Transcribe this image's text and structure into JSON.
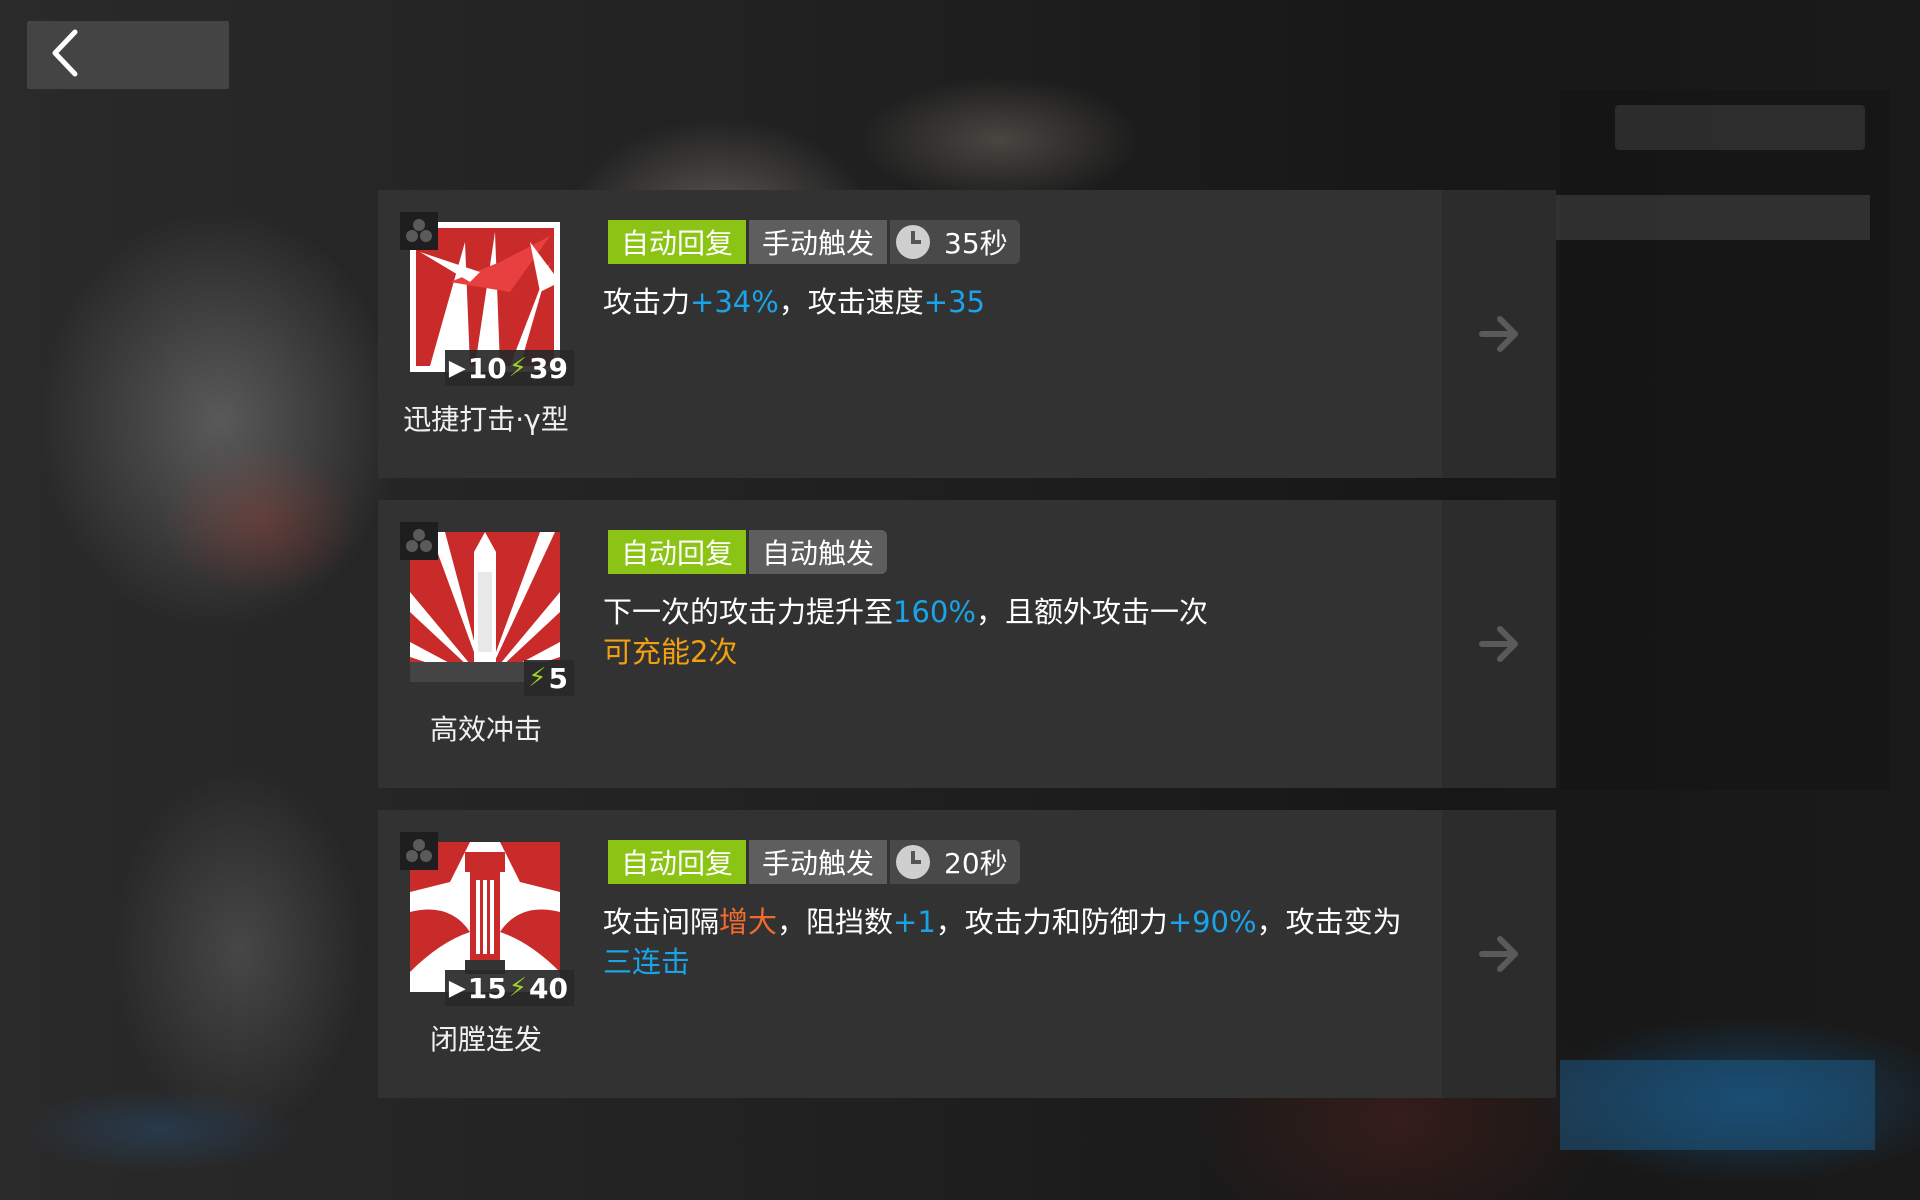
{
  "skills": [
    {
      "name": "迅捷打击·γ型",
      "init_sp": "10",
      "sp_cost": "39",
      "tags": {
        "recovery": "自动回复",
        "trigger": "手动触发",
        "duration": "35秒"
      },
      "desc": {
        "p1": "攻击力",
        "v1": "+34%",
        "p2": "，攻击速度",
        "v2": "+35"
      }
    },
    {
      "name": "高效冲击",
      "sp_cost": "5",
      "tags": {
        "recovery": "自动回复",
        "trigger": "自动触发"
      },
      "desc": {
        "p1": "下一次的攻击力提升至",
        "v1": "160%",
        "p2": "，且额外攻击一次",
        "note": "可充能2次"
      }
    },
    {
      "name": "闭膛连发",
      "init_sp": "15",
      "sp_cost": "40",
      "tags": {
        "recovery": "自动回复",
        "trigger": "手动触发",
        "duration": "20秒"
      },
      "desc": {
        "p1": "攻击间隔",
        "v1": "增大",
        "p2": "，阻挡数",
        "v2": "+1",
        "p3": "，攻击力和防御力",
        "v3": "+90%",
        "p4": "，攻击变为",
        "v4": "三连击"
      }
    }
  ],
  "colors": {
    "tag_green": "#8bc414",
    "value_blue": "#1aa3e8",
    "value_orange_red": "#f26a2e",
    "note_orange": "#f0a012",
    "sp_bolt": "#9ed02a"
  },
  "icons": {
    "back": "chevron-left-icon",
    "arrow": "arrow-right-icon",
    "clock": "clock-icon",
    "rarity": "three-dots-icon",
    "bolt": "lightning-icon",
    "initial_sp": "play-triangle-icon"
  }
}
